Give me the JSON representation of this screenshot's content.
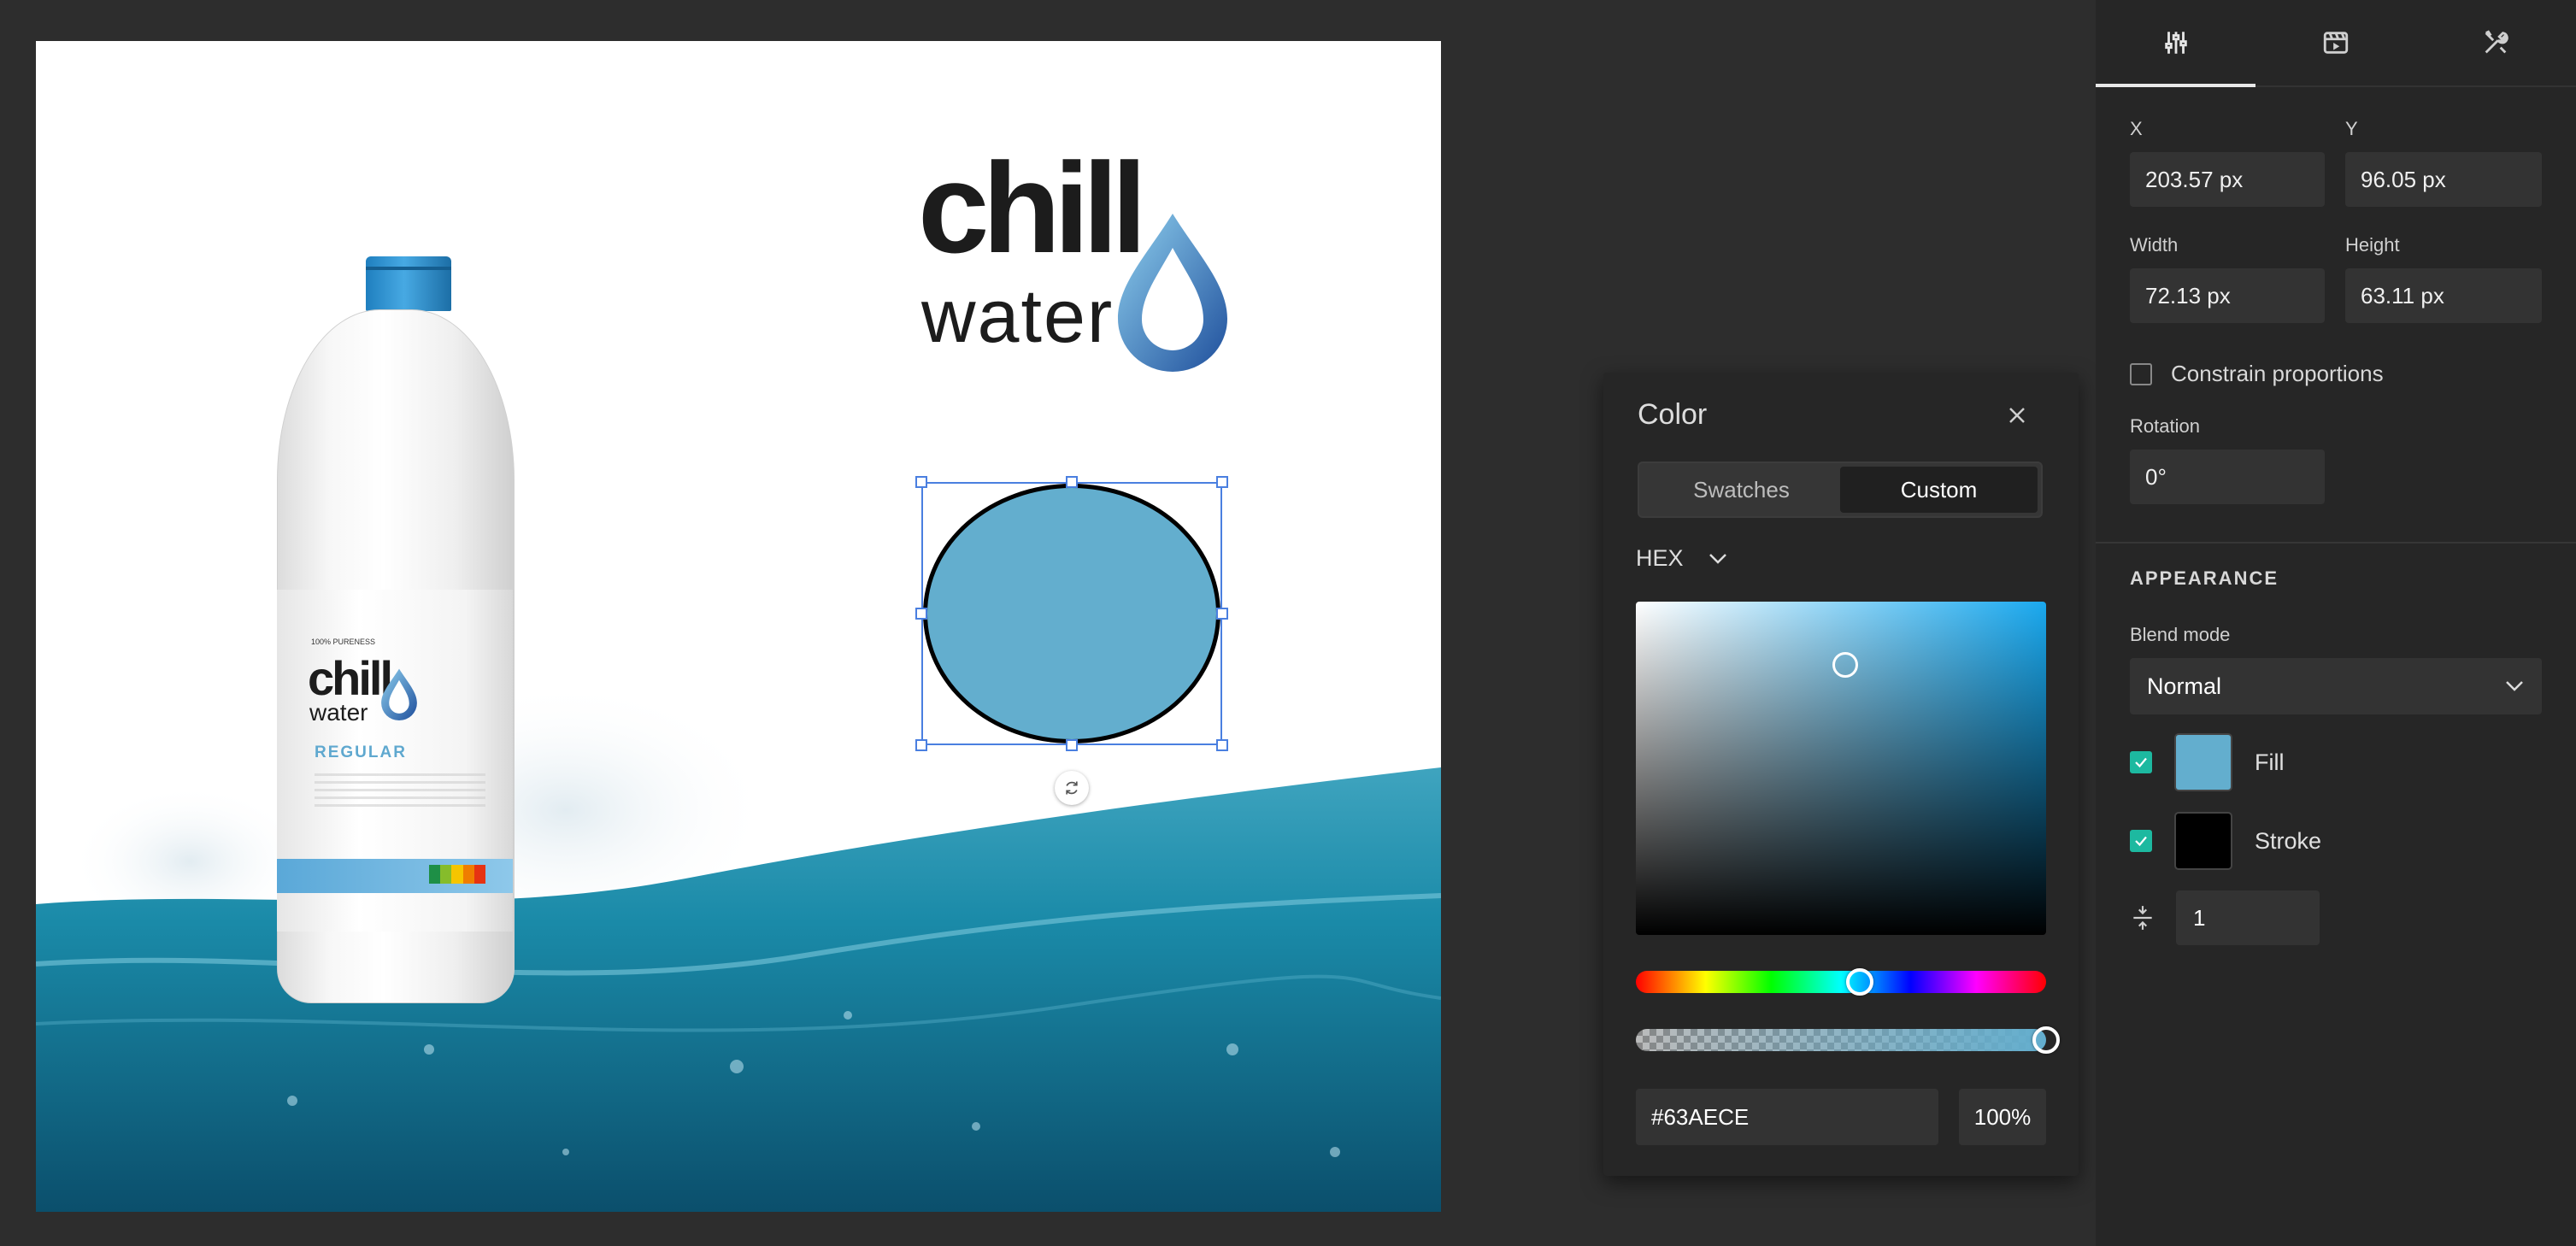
{
  "canvas": {
    "logo": {
      "line1": "chill",
      "line2": "water"
    },
    "bottle": {
      "pureness": "100% PURENESS",
      "logo_line1": "chill",
      "logo_line2": "water",
      "variant": "REGULAR"
    },
    "selected_shape": {
      "fill": "#63AECE",
      "stroke": "#000000"
    }
  },
  "color_panel": {
    "title": "Color",
    "tabs": [
      "Swatches",
      "Custom"
    ],
    "active_tab": "Custom",
    "format": "HEX",
    "hex_value": "#63AECE",
    "alpha_value": "100%",
    "hue_fraction": 0.545,
    "alpha_fraction": 1.0,
    "saturation_fraction": 0.51,
    "brightness_fraction": 0.81
  },
  "properties": {
    "tabs": [
      "sliders-icon",
      "media-icon",
      "tools-icon"
    ],
    "x_label": "X",
    "x_value": "203.57 px",
    "y_label": "Y",
    "y_value": "96.05 px",
    "width_label": "Width",
    "width_value": "72.13 px",
    "height_label": "Height",
    "height_value": "63.11 px",
    "constrain_label": "Constrain proportions",
    "rotation_label": "Rotation",
    "rotation_value": "0°",
    "appearance_title": "APPEARANCE",
    "blend_label": "Blend mode",
    "blend_value": "Normal",
    "fill_label": "Fill",
    "fill_color": "#63AECE",
    "stroke_label": "Stroke",
    "stroke_color": "#000000",
    "stroke_width": "1"
  },
  "colors": {
    "accent": "#1db9a0",
    "selection": "#4a7fe0"
  }
}
